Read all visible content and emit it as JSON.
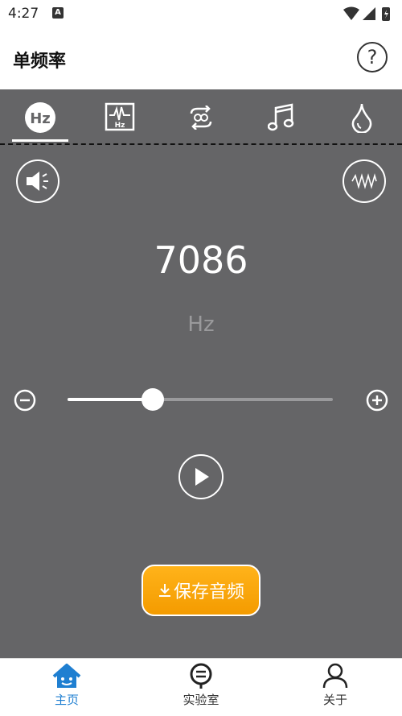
{
  "status_bar": {
    "time": "4:27",
    "notification_icon": "a-icon"
  },
  "header": {
    "title": "单频率",
    "help_icon": "question-icon",
    "help_label": "?"
  },
  "tabs": [
    {
      "name": "hz",
      "label": "Hz",
      "icon": "hz-icon",
      "active": true
    },
    {
      "name": "waveform",
      "label": "Hz",
      "icon": "waveform-hz-icon",
      "active": false
    },
    {
      "name": "loop",
      "label": "",
      "icon": "loop-icon",
      "active": false
    },
    {
      "name": "music",
      "label": "",
      "icon": "music-note-icon",
      "active": false
    },
    {
      "name": "drop",
      "label": "",
      "icon": "water-drop-icon",
      "active": false
    }
  ],
  "controls": {
    "speaker_icon": "speaker-icon",
    "wave_icon": "sine-wave-icon",
    "frequency_value": "7086",
    "frequency_unit": "Hz",
    "slider_fraction": 0.32,
    "minus_icon": "minus-circle-icon",
    "plus_icon": "plus-circle-icon",
    "play_icon": "play-icon"
  },
  "save_button": {
    "label": "保存音频",
    "icon": "download-icon"
  },
  "bottom_nav": [
    {
      "label": "主页",
      "icon": "home-icon",
      "active": true
    },
    {
      "label": "实验室",
      "icon": "lab-icon",
      "active": false
    },
    {
      "label": "关于",
      "icon": "user-icon",
      "active": false
    }
  ],
  "colors": {
    "panel": "#656567",
    "accent_orange": "#f5a200",
    "nav_active": "#1f7fd1"
  }
}
